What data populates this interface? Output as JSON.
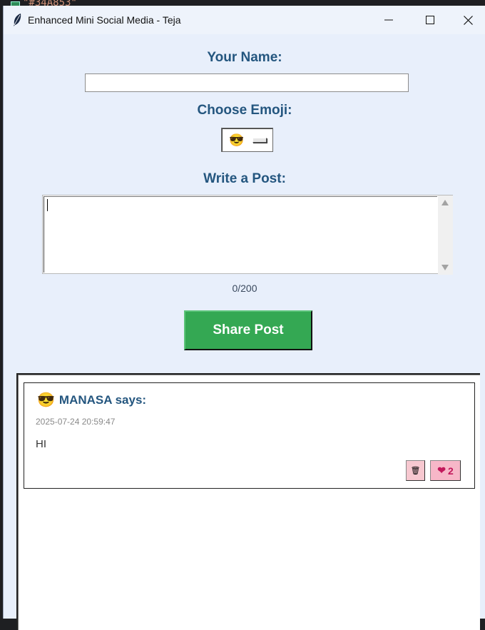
{
  "background": {
    "code_fragment": "\"#34A853\""
  },
  "window": {
    "title": "Enhanced Mini Social Media - Teja",
    "icon": "feather-icon",
    "controls": [
      "minimize-icon",
      "maximize-icon",
      "close-icon"
    ]
  },
  "form": {
    "name_label": "Your Name:",
    "name_value": "",
    "emoji_label": "Choose Emoji:",
    "emoji_selected": "😎",
    "post_label": "Write a Post:",
    "post_value": "",
    "char_count": "0/200",
    "share_label": "Share Post"
  },
  "feed": {
    "posts": [
      {
        "emoji": "😎",
        "author": "MANASA says:",
        "timestamp": "2025-07-24 20:59:47",
        "content": "HI",
        "delete_icon": "🗑",
        "like_icon": "❤",
        "likes": "2"
      }
    ]
  },
  "colors": {
    "accent": "#34A853",
    "label": "#24567F",
    "window_bg": "#E8EFFB",
    "like_bg": "#F7B7C8"
  }
}
